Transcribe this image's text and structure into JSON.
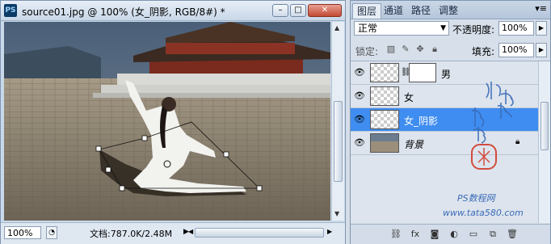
{
  "document": {
    "app_icon": "PS",
    "title": "source01.jpg @ 100% (女_阴影, RGB/8#) *",
    "window_buttons": {
      "minimize": "–",
      "maximize": "□",
      "close": "✕"
    },
    "zoom": "100%",
    "doc_info": "文档:787.0K/2.48M"
  },
  "layers_panel": {
    "tabs": [
      {
        "label": "图层",
        "active": true
      },
      {
        "label": "通道",
        "active": false
      },
      {
        "label": "路径",
        "active": false
      },
      {
        "label": "调整",
        "active": false
      }
    ],
    "menu_icon": "panel-menu-icon",
    "blend_mode": "正常",
    "opacity_label": "不透明度:",
    "opacity_value": "100%",
    "lock_label": "锁定:",
    "fill_label": "填充:",
    "fill_value": "100%",
    "layers": [
      {
        "name": "男",
        "selected": false,
        "has_mask": true
      },
      {
        "name": "女",
        "selected": false,
        "has_mask": false
      },
      {
        "name": "女_阴影",
        "selected": true,
        "has_mask": false
      },
      {
        "name": "背景",
        "selected": false,
        "has_mask": false,
        "locked": true
      }
    ],
    "watermark_line1": "PS数程网",
    "watermark_line2": "www.tata580.com",
    "colors": {
      "selected_row": "#3f8df0",
      "accent": "#3a6bb8"
    }
  }
}
